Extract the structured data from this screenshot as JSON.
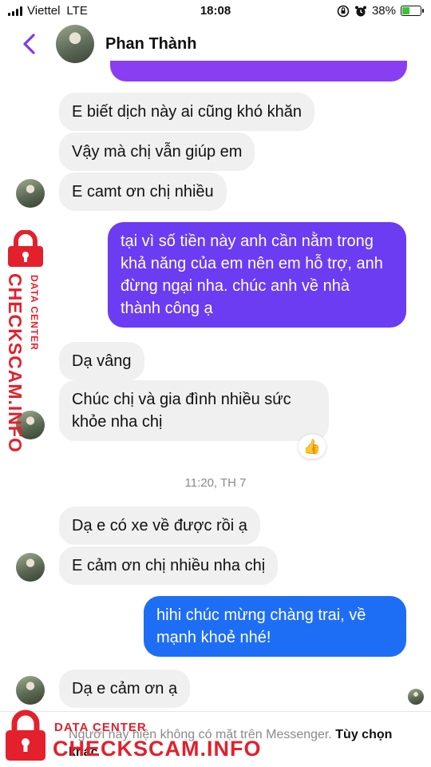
{
  "status_bar": {
    "carrier": "Viettel",
    "network": "LTE",
    "time": "18:08",
    "battery": "38%",
    "battery_level": 0.38
  },
  "header": {
    "back_icon": "chevron-left-icon",
    "contact_name": "Phan Thành",
    "accent_color": "#7b3cf2"
  },
  "messages": [
    {
      "sender": "contact",
      "text": "E biết dịch này ai cũng khó khăn"
    },
    {
      "sender": "contact",
      "text": "Vậy mà chị vẫn giúp em"
    },
    {
      "sender": "contact",
      "text": "E camt ơn chị nhiều"
    },
    {
      "sender": "me",
      "text": "tại vì số tiền này anh cần nằm trong khả năng của em nên em hỗ trợ, anh đừng ngại nha. chúc anh về nhà thành công ạ"
    },
    {
      "sender": "contact",
      "text": "Dạ vâng"
    },
    {
      "sender": "contact",
      "text": "Chúc chị và gia đình nhiều sức khỏe nha chị",
      "reaction": "👍"
    },
    {
      "type": "timestamp",
      "text": "11:20, TH 7"
    },
    {
      "sender": "contact",
      "text": "Dạ e có xe về được rồi ạ"
    },
    {
      "sender": "contact",
      "text": "E cảm ơn chị nhiều nha chị"
    },
    {
      "sender": "me",
      "text": "hihi chúc mừng chàng trai, về mạnh khoẻ nhé!"
    },
    {
      "sender": "contact",
      "text": "Dạ e cảm ơn ạ"
    }
  ],
  "footer_notice": {
    "text": "Người này hiện không có mặt trên Messenger.",
    "link": "Tùy chọn khác"
  },
  "watermark": {
    "line1": "DATA CENTER",
    "line2": "CHECKSCAM.INFO",
    "color": "#e3202c"
  },
  "colors": {
    "outgoing_purple": "#6b3cf2",
    "outgoing_blue": "#1e6ef5",
    "incoming_gray": "#f0f0f0"
  }
}
